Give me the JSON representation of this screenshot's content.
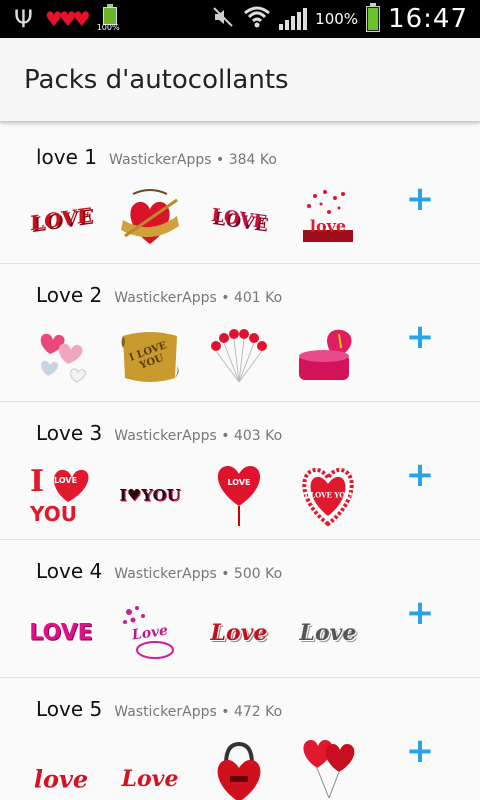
{
  "status_bar": {
    "battery_percent": "100%",
    "small_battery_label": "100%",
    "clock": "16:47",
    "icons": [
      "usb-icon",
      "hearts-notification-icon",
      "battery-notification-icon",
      "mute-icon",
      "wifi-icon",
      "signal-icon",
      "battery-icon"
    ]
  },
  "app_bar": {
    "title": "Packs d'autocollants"
  },
  "packs": [
    {
      "name": "love 1",
      "meta": "WastickerApps • 384 Ko",
      "add_label": "+"
    },
    {
      "name": "Love 2",
      "meta": "WastickerApps • 401 Ko",
      "add_label": "+"
    },
    {
      "name": "Love 3",
      "meta": "WastickerApps • 403 Ko",
      "add_label": "+"
    },
    {
      "name": "Love 4",
      "meta": "WastickerApps • 500 Ko",
      "add_label": "+"
    },
    {
      "name": "Love 5",
      "meta": "WastickerApps • 472 Ko",
      "add_label": "+"
    }
  ],
  "sticker_text": {
    "p1s1": "LOVE",
    "p1s3": "LOVE",
    "p1s4": "love",
    "p2s2": "I LOVE YOU",
    "p3s1a": "I",
    "p3s1b": "LOVE",
    "p3s1c": "YOU",
    "p3s2": "I♥YOU",
    "p3s3": "LOVE",
    "p3s4": "I LOVE YOU",
    "p4s1": "LOVE",
    "p4s2": "Love",
    "p4s3": "Love",
    "p4s4": "Love",
    "p5s1": "love",
    "p5s2": "Love"
  },
  "colors": {
    "accent": "#29a3e8",
    "love_red": "#d9132a"
  }
}
